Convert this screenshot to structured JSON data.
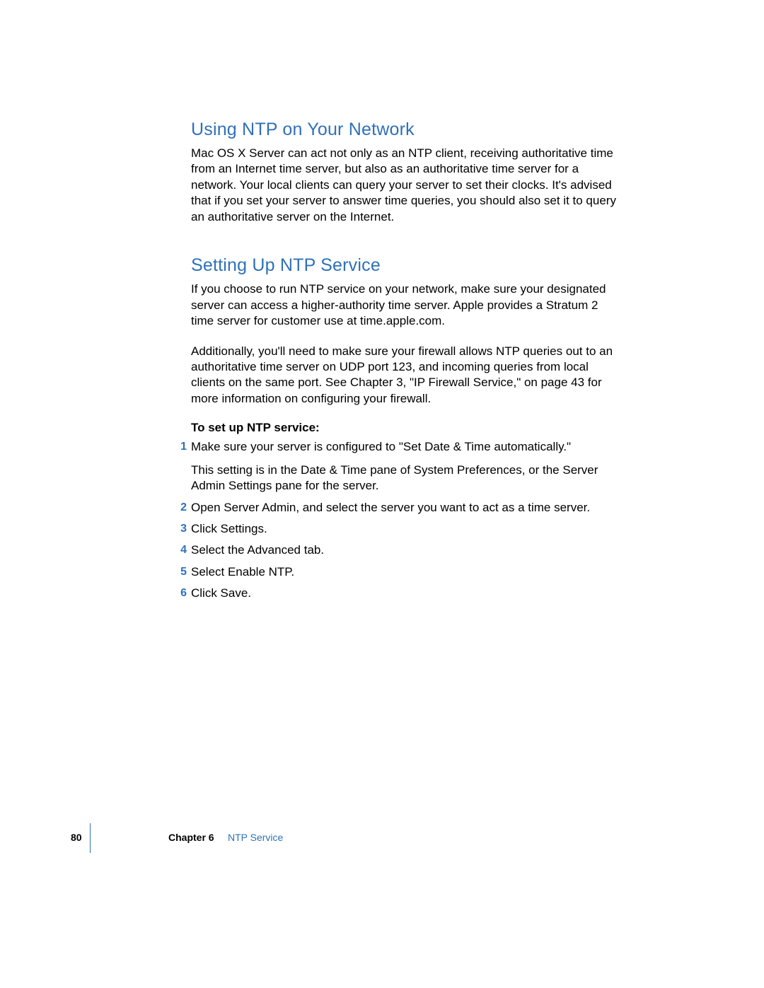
{
  "sections": [
    {
      "heading": "Using NTP on Your Network",
      "paragraphs": [
        "Mac OS X Server can act not only as an NTP client, receiving authoritative time from an Internet time server, but also as an authoritative time server for a network. Your local clients can query your server to set their clocks. It's advised that if you set your server to answer time queries, you should also set it to query an authoritative server on the Internet."
      ]
    },
    {
      "heading": "Setting Up NTP Service",
      "paragraphs": [
        "If you choose to run NTP service on your network, make sure your designated server can access a higher-authority time server. Apple provides a Stratum 2 time server for customer use at time.apple.com.",
        "Additionally, you'll need to make sure your firewall allows NTP queries out to an authoritative time server on UDP port 123, and incoming queries from local clients on the same port. See Chapter 3, \"IP Firewall Service,\" on page 43 for more information on configuring your firewall."
      ],
      "subhead": "To set up NTP service:",
      "steps": [
        {
          "num": "1",
          "text": "Make sure your server is configured to \"Set Date & Time automatically.\"",
          "sub": "This setting is in the Date & Time pane of System Preferences, or the Server Admin Settings pane for the server."
        },
        {
          "num": "2",
          "text": "Open Server Admin, and select the server you want to act as a time server."
        },
        {
          "num": "3",
          "text": "Click Settings."
        },
        {
          "num": "4",
          "text": "Select the Advanced tab."
        },
        {
          "num": "5",
          "text": "Select Enable NTP."
        },
        {
          "num": "6",
          "text": "Click Save."
        }
      ]
    }
  ],
  "footer": {
    "page_number": "80",
    "chapter_label": "Chapter 6",
    "chapter_title": "NTP Service"
  }
}
